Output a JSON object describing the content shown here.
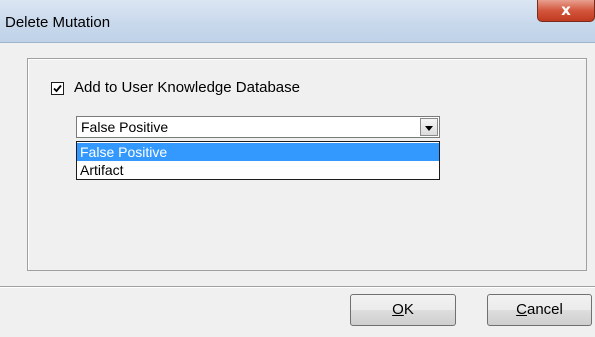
{
  "window": {
    "title": "Delete Mutation",
    "close_glyph": "x"
  },
  "form": {
    "checkbox_checked": true,
    "checkbox_label": "Add to User Knowledge Database",
    "combo_value": "False Positive",
    "options": [
      {
        "label": "False Positive",
        "selected": true
      },
      {
        "label": "Artifact",
        "selected": false
      }
    ]
  },
  "buttons": {
    "ok_accel": "O",
    "ok_rest": "K",
    "cancel_accel": "C",
    "cancel_rest": "ancel"
  },
  "colors": {
    "selection": "#3399ff",
    "close_button": "#c8462b",
    "dialog_bg": "#f0f0f0"
  }
}
